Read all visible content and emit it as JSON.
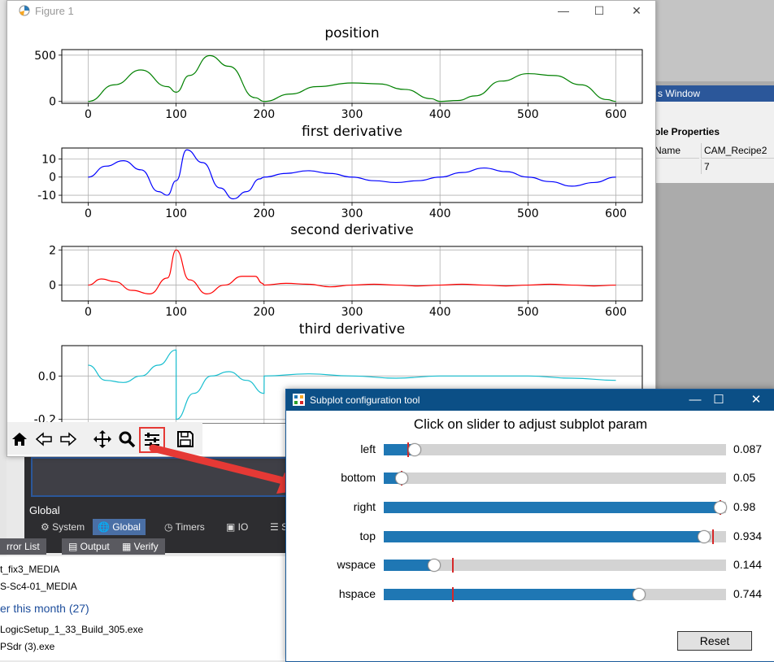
{
  "figure_window": {
    "title": "Figure 1",
    "controls": {
      "minimize": "—",
      "maximize": "☐",
      "close": "✕"
    }
  },
  "plot_titles": [
    "position",
    "first derivative",
    "second derivative",
    "third derivative"
  ],
  "chart_data": [
    {
      "type": "line",
      "title": "position",
      "color": "#008000",
      "x": [
        0,
        30,
        60,
        90,
        100,
        115,
        138,
        160,
        190,
        200,
        230,
        260,
        300,
        330,
        360,
        390,
        400,
        420,
        440,
        470,
        500,
        530,
        560,
        590,
        600
      ],
      "y": [
        0,
        180,
        340,
        160,
        100,
        280,
        495,
        380,
        40,
        0,
        80,
        160,
        200,
        190,
        130,
        30,
        0,
        10,
        60,
        220,
        300,
        280,
        180,
        20,
        0
      ],
      "xlim": [
        -30,
        630
      ],
      "ylim": [
        -20,
        560
      ],
      "xticks": [
        0,
        100,
        200,
        300,
        400,
        500,
        600
      ],
      "yticks": [
        0,
        500
      ],
      "grid": true
    },
    {
      "type": "line",
      "title": "first derivative",
      "color": "#0000ff",
      "x": [
        0,
        20,
        40,
        60,
        80,
        90,
        100,
        112,
        130,
        150,
        165,
        180,
        195,
        200,
        225,
        250,
        275,
        300,
        325,
        350,
        375,
        400,
        425,
        450,
        475,
        500,
        525,
        550,
        575,
        600
      ],
      "y": [
        0,
        6,
        9,
        4,
        -8,
        -10,
        -2,
        15,
        8,
        -6,
        -12,
        -8,
        -1,
        0,
        2,
        3.5,
        2,
        0,
        -2,
        -3,
        -2,
        0,
        2.5,
        5,
        3,
        0,
        -2.5,
        -5,
        -3,
        0
      ],
      "xlim": [
        -30,
        630
      ],
      "ylim": [
        -14,
        16
      ],
      "xticks": [
        0,
        100,
        200,
        300,
        400,
        500,
        600
      ],
      "yticks": [
        -10,
        0,
        10
      ],
      "grid": true
    },
    {
      "type": "line",
      "title": "second derivative",
      "color": "#ff0000",
      "x": [
        0,
        15,
        30,
        50,
        70,
        90,
        100,
        115,
        135,
        155,
        175,
        190,
        198,
        200,
        225,
        250,
        275,
        300,
        325,
        350,
        375,
        400,
        425,
        450,
        475,
        500,
        525,
        550,
        575,
        600
      ],
      "y": [
        0,
        0.35,
        0.2,
        -0.3,
        -0.5,
        0.4,
        2,
        0.3,
        -0.5,
        0,
        0.5,
        0.5,
        0.1,
        0,
        0.1,
        0.05,
        -0.1,
        0,
        0.05,
        0,
        -0.05,
        0,
        0.05,
        0,
        -0.05,
        0,
        0.05,
        0,
        -0.05,
        0
      ],
      "xlim": [
        -30,
        630
      ],
      "ylim": [
        -0.9,
        2.2
      ],
      "xticks": [
        0,
        100,
        200,
        300,
        400,
        500,
        600
      ],
      "yticks": [
        0,
        2
      ],
      "grid": true
    },
    {
      "type": "line",
      "title": "third derivative",
      "color": "#17becf",
      "x": [
        0,
        20,
        40,
        60,
        80,
        100,
        100.1,
        120,
        140,
        160,
        180,
        200,
        200.1,
        250,
        300,
        300.1,
        350,
        400,
        400.1,
        450,
        500,
        500.1,
        550,
        600
      ],
      "y": [
        0.05,
        -0.02,
        -0.03,
        0,
        0.05,
        0.12,
        -0.2,
        -0.08,
        0,
        0.02,
        -0.02,
        -0.08,
        0.0,
        0.01,
        0.0,
        0.0,
        -0.01,
        0.0,
        0.0,
        0.0,
        0.0,
        0.0,
        -0.01,
        -0.02
      ],
      "xlim": [
        -30,
        630
      ],
      "ylim": [
        -0.22,
        0.14
      ],
      "xticks": [
        0,
        100,
        200
      ],
      "yticks": [
        -0.2,
        0.0
      ],
      "grid": true
    }
  ],
  "subplot_tool": {
    "title": "Subplot configuration tool",
    "heading": "Click on slider to adjust subplot param",
    "controls": {
      "minimize": "—",
      "maximize": "☐",
      "close": "✕"
    },
    "sliders": [
      {
        "label": "left",
        "value_text": "0.087",
        "value": 0.087,
        "initial": 0.07
      },
      {
        "label": "bottom",
        "value_text": "0.05",
        "value": 0.05,
        "initial": 0.05
      },
      {
        "label": "right",
        "value_text": "0.98",
        "value": 0.98,
        "initial": 0.98
      },
      {
        "label": "top",
        "value_text": "0.934",
        "value": 0.934,
        "initial": 0.96
      },
      {
        "label": "wspace",
        "value_text": "0.144",
        "value": 0.144,
        "initial": 0.2
      },
      {
        "label": "hspace",
        "value_text": "0.744",
        "value": 0.744,
        "initial": 0.2
      }
    ],
    "reset_label": "Reset"
  },
  "background": {
    "properties_window": "s Window",
    "properties_header": "ole Properties",
    "prop_name_key": "Name",
    "prop_name_value": "CAM_Recipe2",
    "prop_num_value": "7",
    "global_label": "Global",
    "global_tabs": [
      "System",
      "Global",
      "Timers",
      "IO",
      "S"
    ],
    "bottom_tabs": [
      "rror List",
      "Output",
      "Verify"
    ],
    "explorer_items": [
      "t_fix3_MEDIA",
      "S-Sc4-01_MEDIA"
    ],
    "explorer_group": "er this month (27)",
    "explorer_files": [
      "LogicSetup_1_33_Build_305.exe",
      "PSdr (3).exe"
    ]
  },
  "colors": {
    "accent": "#0b4f86",
    "slider_fill": "#1f77b4",
    "arrow": "#e53935"
  }
}
